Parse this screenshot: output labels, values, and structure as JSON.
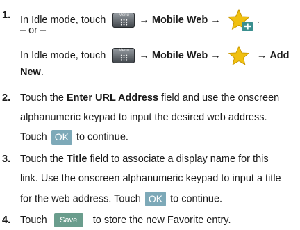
{
  "steps": [
    {
      "number": "1.",
      "line1": {
        "pre": "In Idle mode, touch",
        "arrow1": "→",
        "target": "Mobile Web",
        "arrow2": "→",
        "end": "."
      },
      "or": "– or –",
      "line3": {
        "pre": "In Idle mode, touch",
        "arrow1": "→",
        "target": "Mobile Web",
        "arrow2": "→",
        "arrow3": "→",
        "target2": "Add"
      },
      "line4": {
        "target": "New",
        "end": "."
      }
    },
    {
      "number": "2.",
      "l1_pre": "Touch the ",
      "l1_bold": "Enter URL Address",
      "l1_post": " field and use the onscreen",
      "l2": "alphanumeric keypad to input the desired web address.",
      "l3_pre": "Touch",
      "l3_post": "to continue."
    },
    {
      "number": "3.",
      "l1_pre": "Touch the ",
      "l1_bold": "Title",
      "l1_post": " field to associate a display name for this",
      "l2": "link. Use the onscreen alphanumeric keypad to input a title",
      "l3_pre": "for the web address. Touch",
      "l3_post": "to continue."
    },
    {
      "number": "4.",
      "l1_pre": "Touch",
      "l1_post": "to store the new Favorite entry."
    }
  ],
  "menu_key_label": "Menu",
  "ok_label": "OK",
  "save_label": "Save",
  "icons": {
    "menu": "menu-grid-icon",
    "favorite": "star-add-icon",
    "favorite_plain": "star-icon"
  },
  "colors": {
    "ok_button": "#7da9b8",
    "save_button": "#6a9d8d",
    "star": "#f0c010"
  }
}
